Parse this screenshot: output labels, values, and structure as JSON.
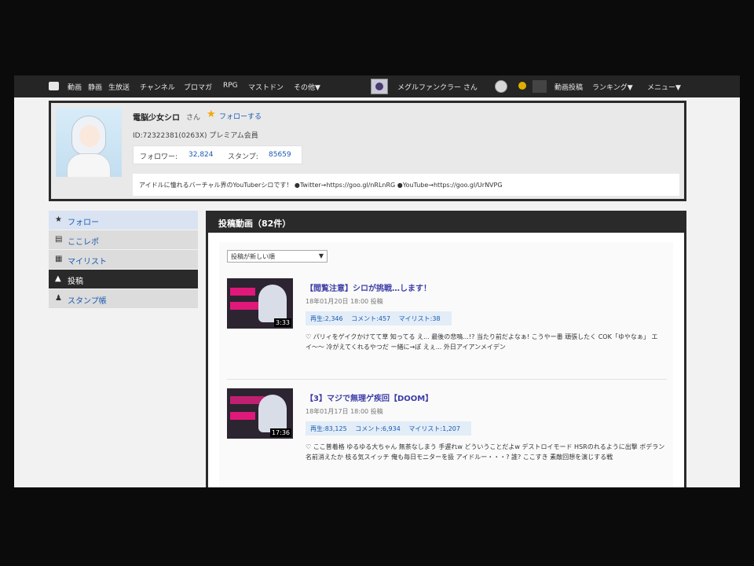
{
  "nav": {
    "items": [
      "動画",
      "静画",
      "生放送",
      "チャンネル",
      "ブロマガ",
      "RPG",
      "マストドン",
      "その他▼"
    ],
    "user_label": "メグルファンクラー さん",
    "points_label": "—",
    "right_items": [
      "動画投稿",
      "ランキング▼",
      "メニュー▼"
    ]
  },
  "profile": {
    "name": "電脳少女シロ",
    "honorific": "さん",
    "follow_label": "フォローする",
    "id_line": "ID:72322381(0263X) プレミアム会員",
    "followers_label": "フォロワー:",
    "followers_value": "32,824",
    "stamp_label": "スタンプ:",
    "stamp_value": "85659",
    "description": "アイドルに憧れるバーチャル界のYouTuberシロです！  ●Twitter→https://goo.gl/nRLnRG   ●YouTube→https://goo.gl/UrNVPG"
  },
  "sidebar": {
    "items": [
      {
        "icon": "★",
        "label": "フォロー"
      },
      {
        "icon": "▤",
        "label": "ここレポ"
      },
      {
        "icon": "▦",
        "label": "マイリスト"
      },
      {
        "icon": "▲",
        "label": "投稿"
      },
      {
        "icon": "♟",
        "label": "スタンプ帳"
      }
    ]
  },
  "main": {
    "header": "投稿動画（82件）",
    "sort_selected": "投稿が新しい順",
    "videos": [
      {
        "title": "【閲覧注意】シロが挑戦…します！",
        "date": "18年01月20日 18:00 投稿",
        "duration": "3:33",
        "views": "再生:2,346",
        "comments": "コメント:457",
        "mylist": "マイリスト:38",
        "description": "♡ パリィをゲイクかけてて草 知ってる え... 最後の悲鳴...!? 当たり前だよなぁ! こうやー番 頑張したく COK「ゆやなぁ」 エイ〜〜 冷がえてくれるやつだ ー緒に→ぽ えぇ... 外日アイアンメイデン"
      },
      {
        "title": "【3】マジで無理ゲ疾回【DOOM】",
        "date": "18年01月17日 18:00 投稿",
        "duration": "17:36",
        "views": "再生:83,125",
        "comments": "コメント:6,934",
        "mylist": "マイリスト:1,207",
        "description": "♡ ここ普着格 ゆるゆる大ちゃん 無茶なしまう 手遅れw どういうことだよw デストロイモード HSRのれるように出撃 ボデラン名前消えたか 枝る気スイッチ 俺も毎日モニターを扱 アイドルー・・・? 誰? ここすき 素敵回想を演じする戦"
      }
    ]
  }
}
